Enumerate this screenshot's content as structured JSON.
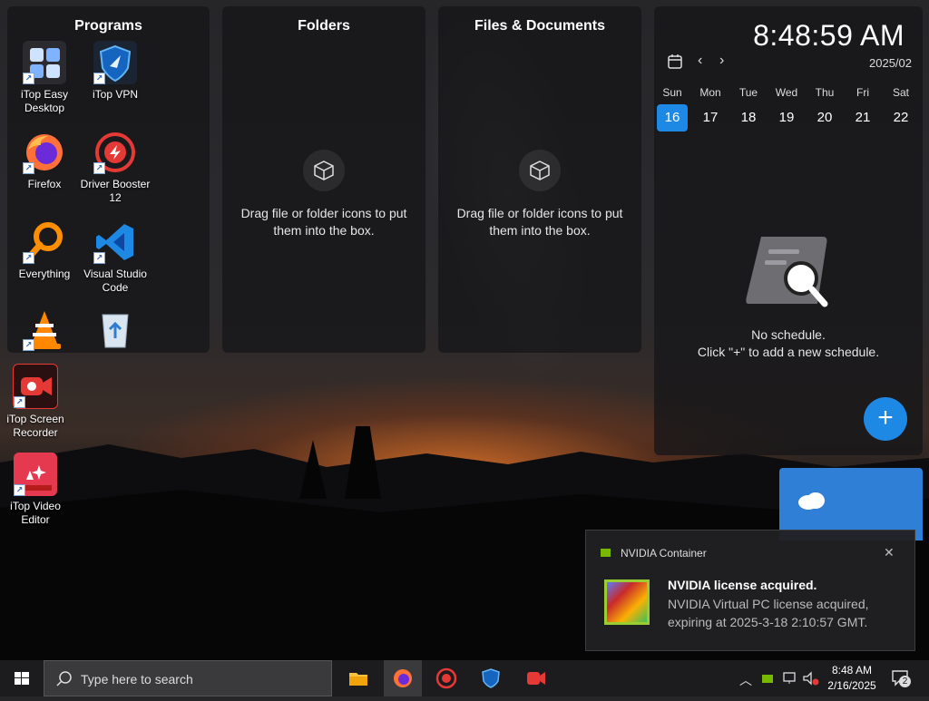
{
  "desktop": {
    "programs_panel": {
      "title": "Programs",
      "icons": [
        {
          "label": "iTop Easy Desktop",
          "icon": "itop-easy-desktop-icon"
        },
        {
          "label": "iTop VPN",
          "icon": "itop-vpn-icon"
        },
        {
          "label": "Firefox",
          "icon": "firefox-icon"
        },
        {
          "label": "Driver Booster 12",
          "icon": "driver-booster-icon"
        },
        {
          "label": "Everything",
          "icon": "everything-search-icon"
        },
        {
          "label": "Visual Studio Code",
          "icon": "vscode-icon"
        },
        {
          "label": "",
          "icon": "vlc-icon"
        },
        {
          "label": "",
          "icon": "recycle-bin-icon"
        }
      ]
    },
    "loose_icons": [
      {
        "label": "iTop Screen Recorder",
        "icon": "itop-screen-recorder-icon"
      },
      {
        "label": "iTop Video Editor",
        "icon": "itop-video-editor-icon"
      }
    ],
    "folders_panel": {
      "title": "Folders",
      "hint": "Drag file or folder icons to put them into the box."
    },
    "files_panel": {
      "title": "Files & Documents",
      "hint": "Drag file or folder icons to put them into the box."
    },
    "calendar": {
      "time": "8:48:59 AM",
      "month": "2025/02",
      "days": [
        {
          "name": "Sun",
          "num": "16",
          "today": true
        },
        {
          "name": "Mon",
          "num": "17"
        },
        {
          "name": "Tue",
          "num": "18"
        },
        {
          "name": "Wed",
          "num": "19"
        },
        {
          "name": "Thu",
          "num": "20"
        },
        {
          "name": "Fri",
          "num": "21"
        },
        {
          "name": "Sat",
          "num": "22"
        }
      ],
      "empty_line1": "No schedule.",
      "empty_line2": "Click \"+\" to add a new schedule.",
      "add_label": "+"
    }
  },
  "notification": {
    "app": "NVIDIA Container",
    "title": "NVIDIA license acquired.",
    "body": "NVIDIA Virtual PC license acquired, expiring at 2025-3-18 2:10:57 GMT.",
    "close": "✕"
  },
  "taskbar": {
    "search_placeholder": "Type here to search",
    "pinned": [
      "file-explorer-icon",
      "firefox-icon",
      "driver-booster-icon",
      "itop-vpn-icon",
      "itop-screen-recorder-icon"
    ],
    "clock_time": "8:48 AM",
    "clock_date": "2/16/2025",
    "notification_count": "2"
  },
  "colors": {
    "accent": "#1e88e5",
    "panel": "#161618"
  }
}
